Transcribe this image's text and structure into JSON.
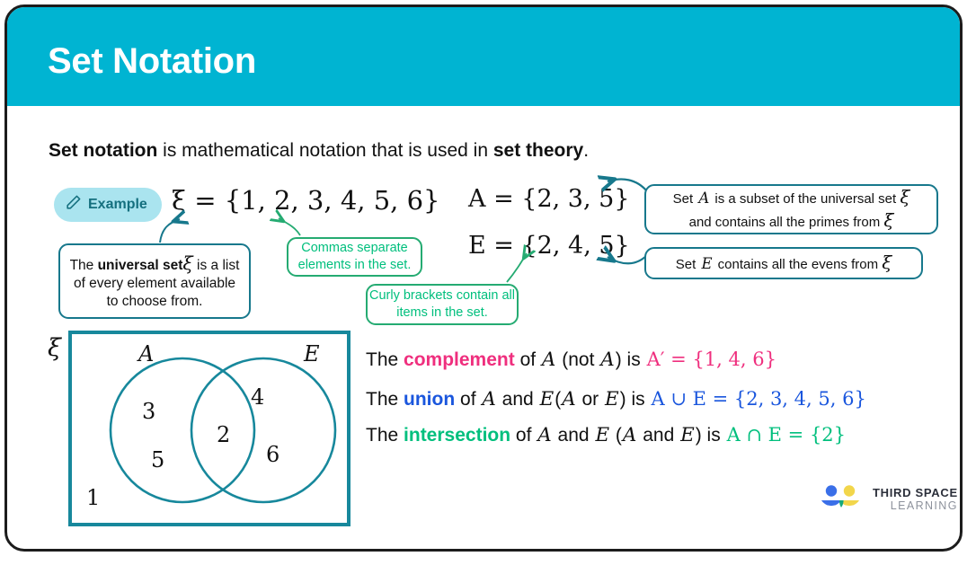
{
  "header": {
    "title": "Set Notation",
    "background": "#00b4d2"
  },
  "intro": {
    "lead": "Set notation",
    "middle": " is mathematical notation that is used in ",
    "tail": "set theory",
    "period": "."
  },
  "example_badge": {
    "label": "Example",
    "icon": "pencil-icon",
    "background": "#aae4ef",
    "text_color": "#15707f"
  },
  "equations": {
    "universal": "ξ = {1, 2, 3, 4, 5, 6}",
    "set_a": "A = {2, 3, 5}",
    "set_e": "E = {2, 4, 5}"
  },
  "callouts": {
    "universal_set": {
      "part1": "The ",
      "bold": "universal set",
      "symbol": "ξ",
      "part2": " is a list of every element available to choose from.",
      "border": "#17788c"
    },
    "commas": {
      "text": "Commas separate elements in the set.",
      "border": "#25ab72"
    },
    "curly": {
      "text": "Curly brackets contain all items in the set.",
      "border": "#25ab72"
    },
    "set_a_note": {
      "part1": "Set ",
      "var1": "A",
      "part2": " is a subset of the universal set ",
      "symbol1": "ξ",
      "part3": "and contains all the primes from ",
      "symbol2": "ξ",
      "border": "#17788c"
    },
    "set_e_note": {
      "part1": "Set ",
      "var1": "E",
      "part2": " contains all the evens from ",
      "symbol1": "ξ",
      "border": "#17788c"
    }
  },
  "venn": {
    "universal_label": "ξ",
    "set_a_label": "A",
    "set_e_label": "E",
    "a_only": [
      "3",
      "5"
    ],
    "intersection": [
      "2"
    ],
    "e_only": [
      "4",
      "6"
    ],
    "outside": [
      "1"
    ],
    "stroke": "#17889c"
  },
  "statements": {
    "complement": {
      "prefix": "The ",
      "keyword": "complement",
      "mid1": " of ",
      "var1": "A",
      "mid2": "(not ",
      "var2": "A",
      "mid3": ") is ",
      "result": "A′ = {1, 4, 6}",
      "color": "#ef2f7e"
    },
    "union": {
      "prefix": "The ",
      "keyword": "union",
      "mid1": " of ",
      "var1": "A",
      "mid2": " and ",
      "var2": "E",
      "mid3": "(",
      "var3": "A",
      "mid4": " or ",
      "var4": "E",
      "mid5": ") is  ",
      "result": "A ∪ E = {2, 3, 4, 5, 6}",
      "color": "#1a56dd"
    },
    "intersection": {
      "prefix": "The ",
      "keyword": "intersection",
      "mid1": " of ",
      "var1": "A",
      "mid2": " and ",
      "var2": "E",
      "mid3": " (",
      "var3": "A",
      "mid4": " and ",
      "var4": "E",
      "mid5": ") is  ",
      "result": "A ∩ E = {2}",
      "color": "#00bf7d"
    }
  },
  "logo": {
    "line1": "THIRD SPACE",
    "line2": "LEARNING",
    "blue": "#3a6fe8",
    "yellow": "#f2d64b",
    "green": "#16a97c"
  }
}
